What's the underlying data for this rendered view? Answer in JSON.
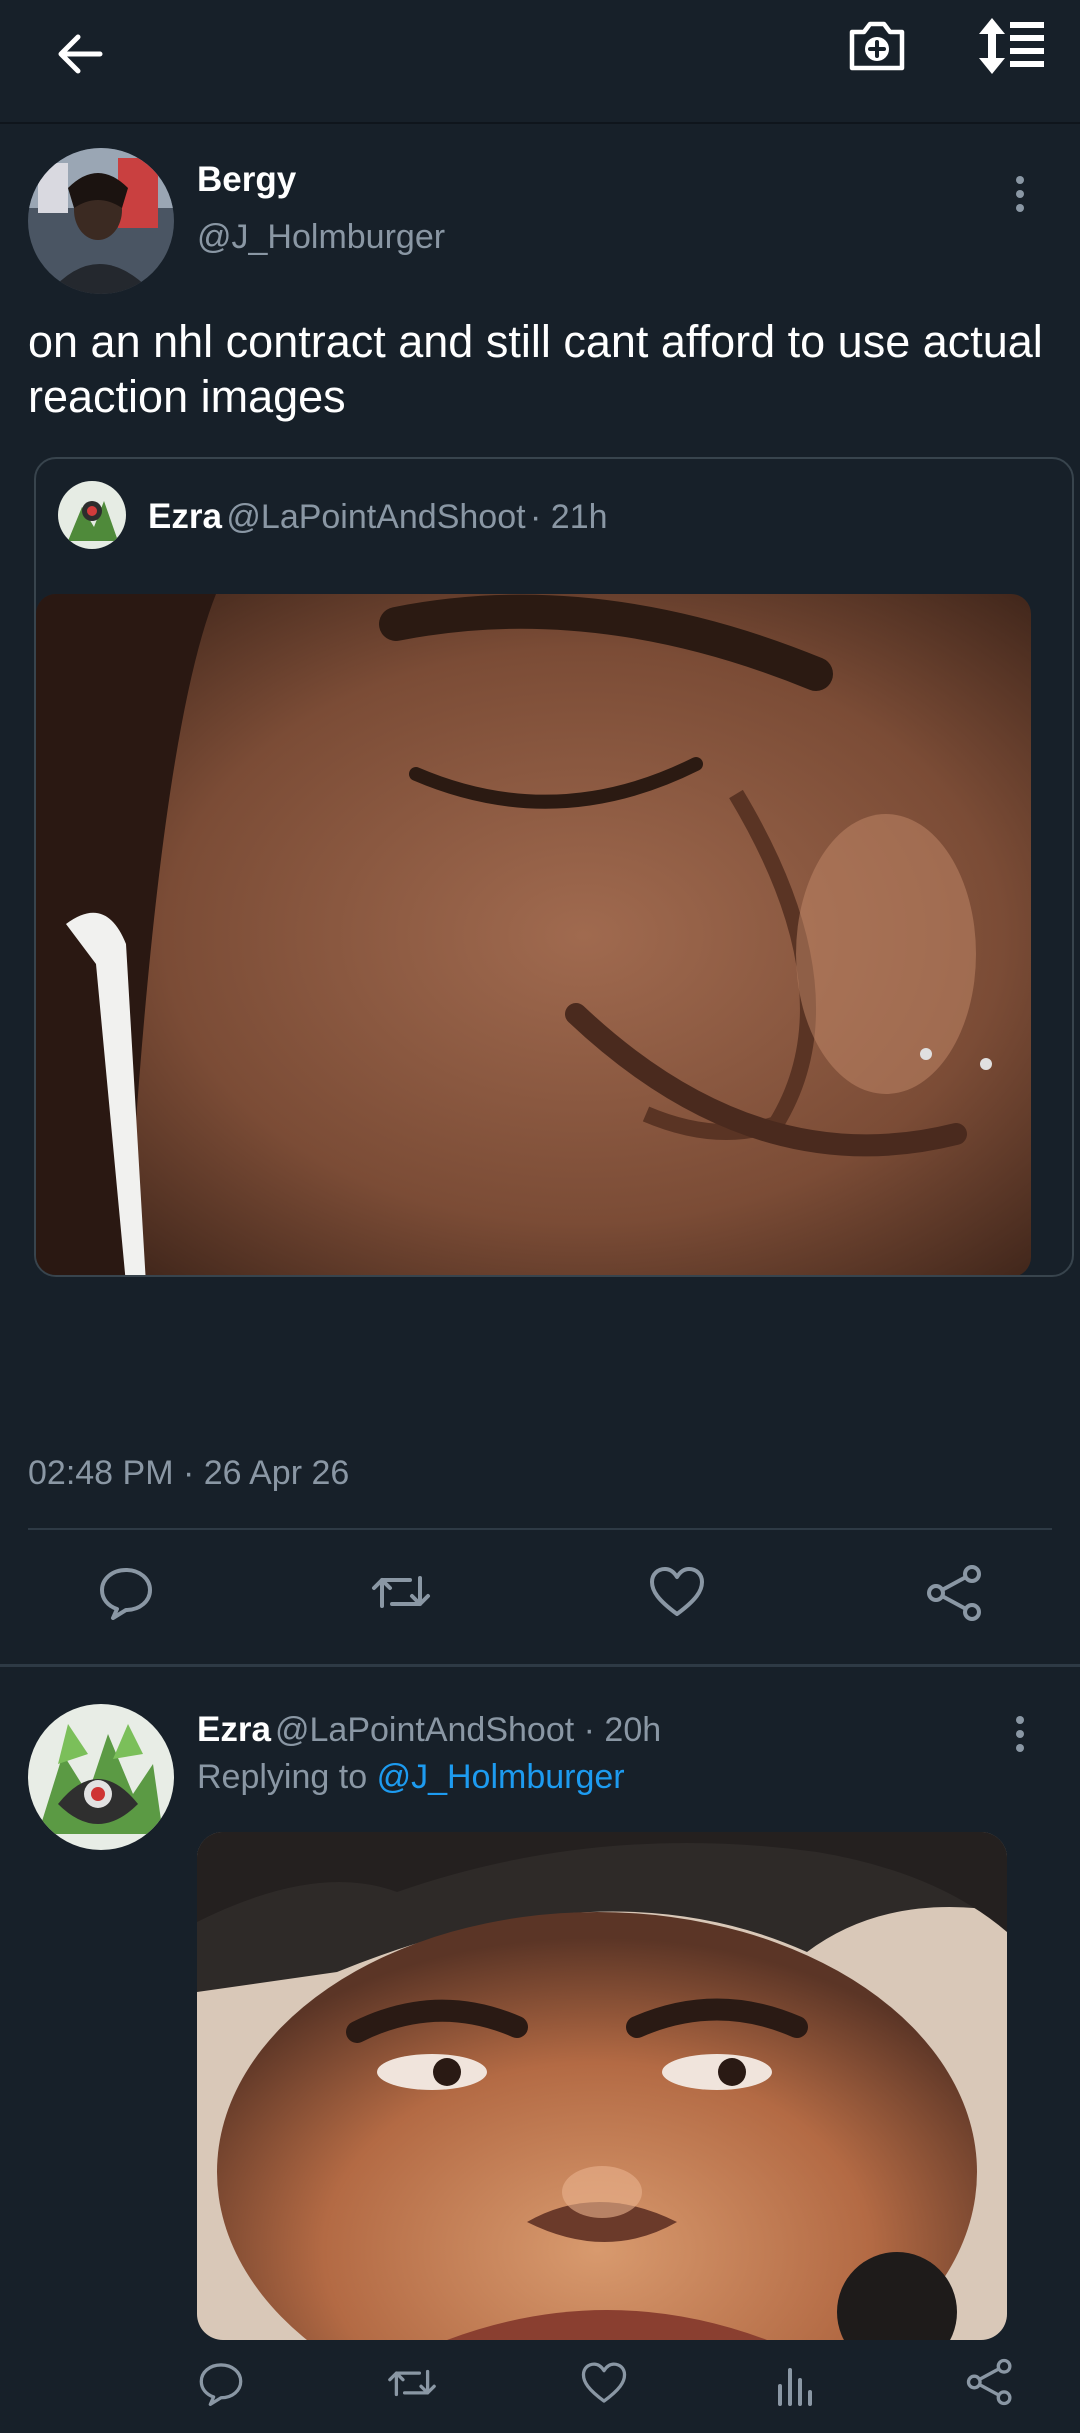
{
  "topbar": {
    "back": "back-arrow-icon",
    "camera": "camera-add-icon",
    "sort": "sort-icon"
  },
  "tweet": {
    "name": "Bergy",
    "handle": "@J_Holmburger",
    "text": "on an nhl contract and still cant afford to use actual reaction images",
    "timestamp": "02:48 PM · 26 Apr 26",
    "quote": {
      "name": "Ezra",
      "handle": "@LaPointAndShoot",
      "time": "· 21h"
    }
  },
  "reply": {
    "name": "Ezra",
    "handle": "@LaPointAndShoot",
    "time": "· 20h",
    "replying_prefix": "Replying to",
    "replying_handle": "@J_Holmburger"
  },
  "colors": {
    "background": "#172029",
    "secondary_text": "#8a97a4",
    "link": "#1d9bf0",
    "divider": "#2e3a45"
  }
}
